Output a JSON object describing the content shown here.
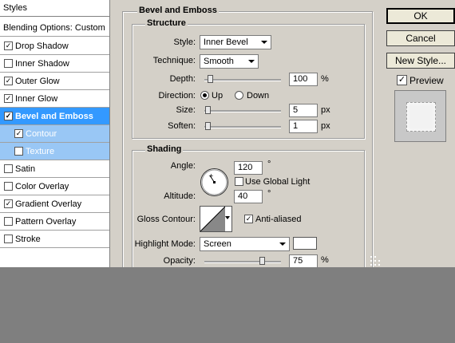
{
  "styles_list": {
    "header": "Styles",
    "items": [
      {
        "label": "Blending Options: Custom",
        "checkbox": false,
        "checked": false,
        "state": "normal"
      },
      {
        "label": "Drop Shadow",
        "checkbox": true,
        "checked": true,
        "state": "normal"
      },
      {
        "label": "Inner Shadow",
        "checkbox": true,
        "checked": false,
        "state": "normal"
      },
      {
        "label": "Outer Glow",
        "checkbox": true,
        "checked": true,
        "state": "normal"
      },
      {
        "label": "Inner Glow",
        "checkbox": true,
        "checked": true,
        "state": "normal"
      },
      {
        "label": "Bevel and Emboss",
        "checkbox": true,
        "checked": true,
        "state": "selected"
      },
      {
        "label": "Contour",
        "checkbox": true,
        "checked": true,
        "state": "sub"
      },
      {
        "label": "Texture",
        "checkbox": true,
        "checked": false,
        "state": "sub"
      },
      {
        "label": "Satin",
        "checkbox": true,
        "checked": false,
        "state": "normal"
      },
      {
        "label": "Color Overlay",
        "checkbox": true,
        "checked": false,
        "state": "normal"
      },
      {
        "label": "Gradient Overlay",
        "checkbox": true,
        "checked": true,
        "state": "normal"
      },
      {
        "label": "Pattern Overlay",
        "checkbox": true,
        "checked": false,
        "state": "normal"
      },
      {
        "label": "Stroke",
        "checkbox": true,
        "checked": false,
        "state": "normal"
      }
    ]
  },
  "panel": {
    "title": "Bevel and Emboss",
    "structure": {
      "title": "Structure",
      "style_label": "Style:",
      "style_value": "Inner Bevel",
      "technique_label": "Technique:",
      "technique_value": "Smooth",
      "depth_label": "Depth:",
      "depth_value": "100",
      "depth_unit": "%",
      "direction_label": "Direction:",
      "direction_up": "Up",
      "direction_down": "Down",
      "direction_selected": "Up",
      "size_label": "Size:",
      "size_value": "5",
      "size_unit": "px",
      "soften_label": "Soften:",
      "soften_value": "1",
      "soften_unit": "px"
    },
    "shading": {
      "title": "Shading",
      "angle_label": "Angle:",
      "angle_value": "120",
      "angle_unit": "°",
      "use_global_light_label": "Use Global Light",
      "use_global_light_checked": false,
      "altitude_label": "Altitude:",
      "altitude_value": "40",
      "altitude_unit": "°",
      "gloss_contour_label": "Gloss Contour:",
      "anti_aliased_label": "Anti-aliased",
      "anti_aliased_checked": true,
      "highlight_mode_label": "Highlight Mode:",
      "highlight_mode_value": "Screen",
      "highlight_color": "#ffffff",
      "opacity_label": "Opacity:",
      "opacity_value": "75",
      "opacity_unit": "%"
    }
  },
  "buttons": {
    "ok": "OK",
    "cancel": "Cancel",
    "new_style": "New Style...",
    "preview_label": "Preview",
    "preview_checked": true
  },
  "colors": {
    "dialog_bg": "#d4d0c8",
    "selection": "#3399ff",
    "sub_selection": "#99c7f5",
    "backdrop": "#7f7f7f"
  }
}
